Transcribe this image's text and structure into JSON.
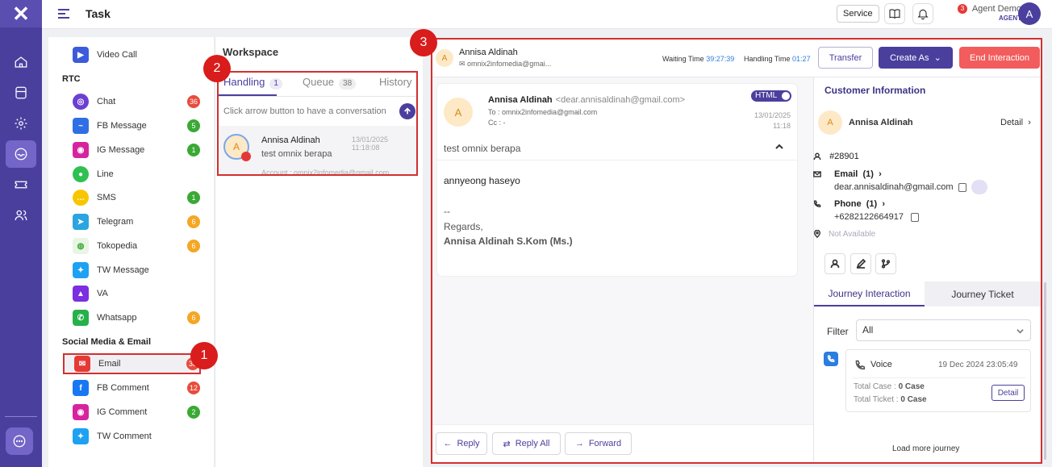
{
  "topbar": {
    "page_title": "Task",
    "service_label": "Service",
    "notification_count": "3",
    "agent_name": "Agent Demo",
    "agent_role": "AGENT",
    "avatar_initial": "A"
  },
  "channels": {
    "groups": [
      "RTC",
      "Social Media & Email"
    ],
    "items": [
      {
        "label": "Video Call",
        "badge": ""
      },
      {
        "label": "Chat",
        "badge": "36"
      },
      {
        "label": "FB Message",
        "badge": "5"
      },
      {
        "label": "IG Message",
        "badge": "1"
      },
      {
        "label": "Line",
        "badge": ""
      },
      {
        "label": "SMS",
        "badge": "1"
      },
      {
        "label": "Telegram",
        "badge": "6"
      },
      {
        "label": "Tokopedia",
        "badge": "6"
      },
      {
        "label": "TW Message",
        "badge": ""
      },
      {
        "label": "VA",
        "badge": ""
      },
      {
        "label": "Whatsapp",
        "badge": "6"
      },
      {
        "label": "Email",
        "badge": "38"
      },
      {
        "label": "FB Comment",
        "badge": "12"
      },
      {
        "label": "IG Comment",
        "badge": "2"
      },
      {
        "label": "TW Comment",
        "badge": ""
      }
    ]
  },
  "annotations": [
    "1",
    "2",
    "3"
  ],
  "workspace": {
    "title": "Workspace",
    "tabs": [
      {
        "label": "Handling",
        "count": "1"
      },
      {
        "label": "Queue",
        "count": "38"
      },
      {
        "label": "History",
        "count": ""
      }
    ],
    "hint": "Click arrow button to have a conversation",
    "conversation": {
      "initial": "A",
      "name": "Annisa Aldinah",
      "time": "13/01/2025 11:18:08",
      "message": "test omnix berapa",
      "account": "Account : omnix2infomedia@gmail.com"
    }
  },
  "interaction": {
    "initial": "A",
    "customer_name": "Annisa Aldinah",
    "account_email": "omnix2infomedia@gmai...",
    "waiting_label": "Waiting Time",
    "waiting_value": "39:27:39",
    "handling_label": "Handling Time",
    "handling_value": "01:27",
    "transfer_label": "Transfer",
    "create_label": "Create As",
    "end_label": "End Interaction"
  },
  "email": {
    "initial": "A",
    "from_name": "Annisa Aldinah",
    "from_addr": "<dear.annisaldinah@gmail.com>",
    "to": "To : omnix2infomedia@gmail.com",
    "cc": "Cc : -",
    "html_label": "HTML",
    "date": "13/01/2025",
    "time": "11:18",
    "subject": "test omnix berapa",
    "body_line1": "annyeong haseyo",
    "body_line2": "--",
    "body_line3": "Regards,",
    "body_line4": "Annisa Aldinah S.Kom (Ms.)",
    "reply_label": "Reply",
    "reply_all_label": "Reply All",
    "forward_label": "Forward"
  },
  "customer": {
    "title": "Customer Information",
    "initial": "A",
    "name": "Annisa Aldinah",
    "detail_label": "Detail",
    "id": "#28901",
    "email_label": "Email",
    "email_count": "(1)",
    "email_value": "dear.annisaldinah@gmail.com",
    "phone_label": "Phone",
    "phone_count": "(1)",
    "phone_value": "+6282122664917",
    "address": "Not Available"
  },
  "journey": {
    "tab_interaction": "Journey Interaction",
    "tab_ticket": "Journey Ticket",
    "filter_label": "Filter",
    "filter_value": "All",
    "card_channel": "Voice",
    "card_date": "19 Dec 2024 23:05:49",
    "total_case_label": "Total Case :",
    "total_case_value": "0 Case",
    "total_ticket_label": "Total Ticket :",
    "total_ticket_value": "0 Case",
    "card_detail": "Detail",
    "load_more": "Load more journey"
  }
}
